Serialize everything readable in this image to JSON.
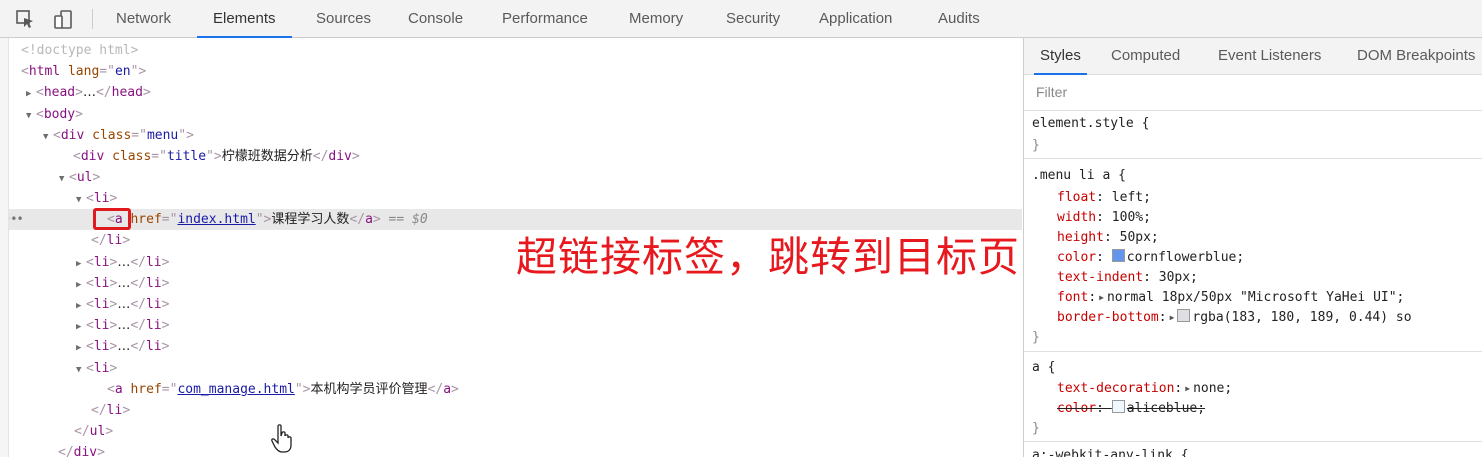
{
  "toolbar": {
    "icons": [
      "inspect-element-icon",
      "device-toolbar-icon"
    ],
    "tabs": [
      "Network",
      "Elements",
      "Sources",
      "Console",
      "Performance",
      "Memory",
      "Security",
      "Application",
      "Audits"
    ],
    "active_tab": "Elements"
  },
  "tree": {
    "doctype": "<!doctype html>",
    "html_tag": "html",
    "html_attr_name": "lang",
    "html_attr_value": "en",
    "head_tag": "head",
    "ellipsis": "…",
    "body_tag": "body",
    "div_tag": "div",
    "menu_class_attr": "class",
    "menu_class_value": "menu",
    "title_class_value": "title",
    "title_text": "柠檬班数据分析",
    "ul_tag": "ul",
    "li_tag": "li",
    "a_tag": "a",
    "href_attr": "href",
    "first_href": "index.html",
    "first_link_text": "课程学习人数",
    "selected_marker": "== $0",
    "last_href": "com_manage.html",
    "last_link_text": "本机构学员评价管理",
    "dots": "•••"
  },
  "overlay_text": "超链接标签，跳转到目标页面",
  "styles_panel": {
    "tabs": [
      "Styles",
      "Computed",
      "Event Listeners",
      "DOM Breakpoints"
    ],
    "active_tab": "Styles",
    "filter_placeholder": "Filter",
    "element_style": "element.style {",
    "close_brace": "}",
    "rule1_selector": ".menu li a {",
    "rule1_props": [
      {
        "name": "float",
        "value": "left;"
      },
      {
        "name": "width",
        "value": "100%;"
      },
      {
        "name": "height",
        "value": "50px;"
      },
      {
        "name": "color",
        "value": "cornflowerblue;"
      },
      {
        "name": "text-indent",
        "value": "30px;"
      },
      {
        "name": "font",
        "value": "normal 18px/50px \"Microsoft YaHei UI\";"
      },
      {
        "name": "border-bottom",
        "value": "rgba(183, 180, 189, 0.44) so"
      }
    ],
    "rule2_selector": "a {",
    "rule2_props": [
      {
        "name": "text-decoration",
        "value": "none;"
      },
      {
        "name": "color",
        "value": "aliceblue;"
      }
    ],
    "rule3_selector": "a:-webkit-any-link {",
    "colors": {
      "cornflowerblue": "#6495ed",
      "aliceblue": "#f0f8ff",
      "border": "#b7b4bd"
    }
  }
}
